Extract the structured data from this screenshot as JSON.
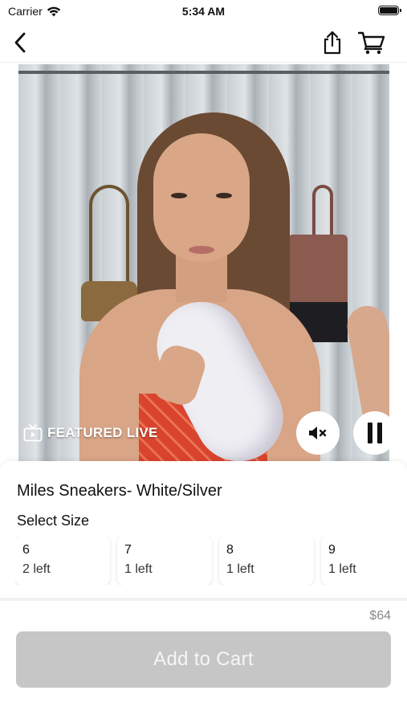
{
  "status": {
    "carrier": "Carrier",
    "time": "5:34 AM"
  },
  "nav": {
    "back_icon": "chevron-left-icon",
    "share_icon": "share-icon",
    "cart_icon": "cart-icon"
  },
  "video": {
    "badge": "FEATURED LIVE",
    "tv_icon": "tv-icon",
    "mute_icon": "mute-icon",
    "pause_icon": "pause-icon"
  },
  "product": {
    "title": "Miles Sneakers- White/Silver",
    "select_size_label": "Select Size",
    "sizes": [
      {
        "size": "6",
        "stock": "2 left"
      },
      {
        "size": "7",
        "stock": "1 left"
      },
      {
        "size": "8",
        "stock": "1 left"
      },
      {
        "size": "9",
        "stock": "1 left"
      }
    ],
    "price": "$64",
    "add_to_cart_label": "Add to Cart",
    "add_to_cart_color": "#c6c6c6"
  }
}
